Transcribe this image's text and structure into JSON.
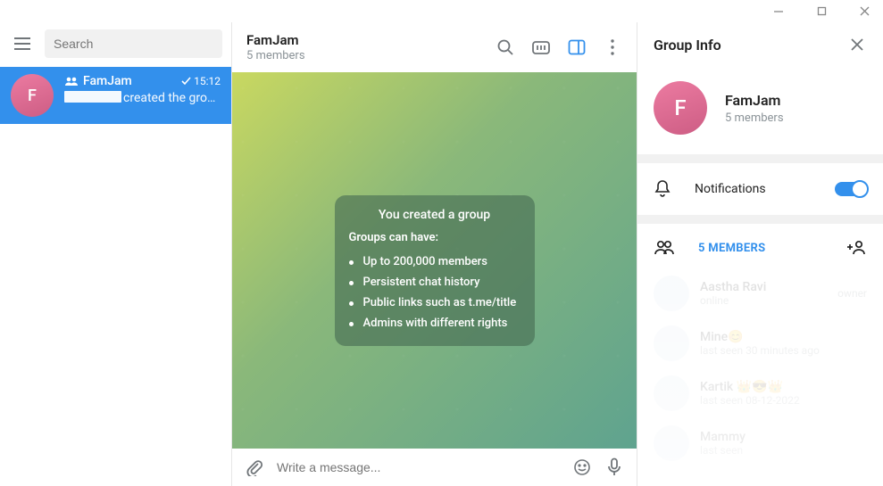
{
  "titlebar": {
    "min": "—",
    "max": "□",
    "close": "✕"
  },
  "left": {
    "search_placeholder": "Search",
    "chats": [
      {
        "name": "FamJam",
        "time": "15:12",
        "preview_suffix": "created the grou…",
        "initial": "F"
      }
    ]
  },
  "center": {
    "title": "FamJam",
    "subtitle": "5 members",
    "infocard": {
      "title": "You created a group",
      "subtitle": "Groups can have:",
      "bullets": [
        "Up to 200,000 members",
        "Persistent chat history",
        "Public links such as t.me/title",
        "Admins with different rights"
      ]
    },
    "compose_placeholder": "Write a message..."
  },
  "right": {
    "title": "Group Info",
    "profile": {
      "title": "FamJam",
      "subtitle": "5 members",
      "initial": "F"
    },
    "notifications_label": "Notifications",
    "members_label": "5 MEMBERS",
    "members": [
      {
        "name": "Aastha Ravi",
        "status": "online",
        "role": "owner"
      },
      {
        "name": "Mine😊",
        "status": "last seen 30 minutes ago",
        "role": ""
      },
      {
        "name": "Kartik 👑😎👑",
        "status": "last seen 08-12-2022",
        "role": ""
      },
      {
        "name": "Mammy",
        "status": "last seen",
        "role": ""
      }
    ]
  }
}
